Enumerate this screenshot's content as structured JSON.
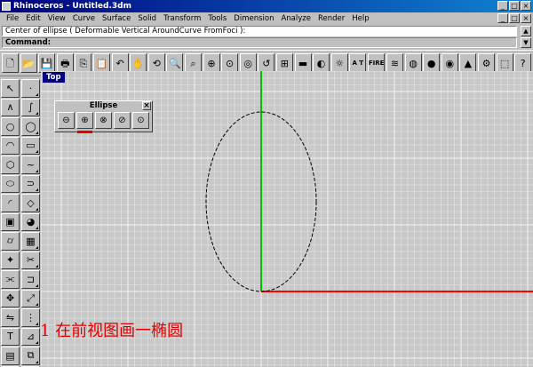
{
  "window": {
    "title": "Rhinoceros - Untitled.3dm",
    "min": "_",
    "max": "□",
    "close": "×"
  },
  "menu": [
    "File",
    "Edit",
    "View",
    "Curve",
    "Surface",
    "Solid",
    "Transform",
    "Tools",
    "Dimension",
    "Analyze",
    "Render",
    "Help"
  ],
  "mdi": {
    "min": "_",
    "max": "□",
    "close": "×"
  },
  "command": {
    "history": "Center of ellipse ( Deformable Vertical AroundCurve FromFoci ):",
    "prompt": "Command:"
  },
  "toolbar": {
    "buttons": [
      {
        "name": "new-icon",
        "glyph": "🗋"
      },
      {
        "name": "open-icon",
        "glyph": "📂"
      },
      {
        "name": "save-icon",
        "glyph": "💾"
      },
      {
        "name": "print-icon",
        "glyph": "🖶"
      },
      {
        "name": "copy-icon",
        "glyph": "⎘"
      },
      {
        "name": "paste-icon",
        "glyph": "📋"
      },
      {
        "name": "undo-icon",
        "glyph": "↶"
      },
      {
        "name": "pan-icon",
        "glyph": "✋"
      },
      {
        "name": "rotate-view-icon",
        "glyph": "⟲"
      },
      {
        "name": "zoom-icon",
        "glyph": "🔍"
      },
      {
        "name": "zoom-window-icon",
        "glyph": "⌕"
      },
      {
        "name": "zoom-extents-icon",
        "glyph": "⊕"
      },
      {
        "name": "zoom-selected-icon",
        "glyph": "⊙"
      },
      {
        "name": "zoom-target-icon",
        "glyph": "◎"
      },
      {
        "name": "undo-view-icon",
        "glyph": "↺"
      },
      {
        "name": "four-views-icon",
        "glyph": "⊞"
      },
      {
        "name": "cplane-icon",
        "glyph": "▬"
      },
      {
        "name": "shade-icon",
        "glyph": "◐"
      },
      {
        "name": "render-icon",
        "glyph": "☼"
      },
      {
        "name": "text-lbl-icon",
        "glyph": "A T",
        "label": true
      },
      {
        "name": "osnap-icon",
        "glyph": "FIRE",
        "label": true
      },
      {
        "name": "layer-icon",
        "glyph": "≋"
      },
      {
        "name": "color-wheel-icon",
        "glyph": "◍"
      },
      {
        "name": "sphere-icon",
        "glyph": "●"
      },
      {
        "name": "material-icon",
        "glyph": "◉"
      },
      {
        "name": "light-icon",
        "glyph": "▲"
      },
      {
        "name": "options-icon",
        "glyph": "⚙"
      },
      {
        "name": "properties-icon",
        "glyph": "⬚"
      },
      {
        "name": "help-icon",
        "glyph": "?"
      }
    ]
  },
  "left_toolbar": {
    "buttons": [
      {
        "name": "select-icon",
        "glyph": "↖"
      },
      {
        "name": "point-icon",
        "glyph": "·"
      },
      {
        "name": "polyline-icon",
        "glyph": "∧"
      },
      {
        "name": "curve-icon",
        "glyph": "∫"
      },
      {
        "name": "circle-icon",
        "glyph": "○"
      },
      {
        "name": "ellipse-icon",
        "glyph": "◯"
      },
      {
        "name": "arc-icon",
        "glyph": "◠"
      },
      {
        "name": "rectangle-icon",
        "glyph": "▭"
      },
      {
        "name": "polygon-icon",
        "glyph": "⬡"
      },
      {
        "name": "freeform-icon",
        "glyph": "~"
      },
      {
        "name": "text-object-icon",
        "glyph": "⬭"
      },
      {
        "name": "offset-icon",
        "glyph": "⊃"
      },
      {
        "name": "fillet-icon",
        "glyph": "◜"
      },
      {
        "name": "surface-icon",
        "glyph": "◇"
      },
      {
        "name": "box-icon",
        "glyph": "▣"
      },
      {
        "name": "sphere-solid-icon",
        "glyph": "◕"
      },
      {
        "name": "cylinder-icon",
        "glyph": "⌭"
      },
      {
        "name": "mesh-icon",
        "glyph": "▦"
      },
      {
        "name": "explode-icon",
        "glyph": "✦"
      },
      {
        "name": "trim-icon",
        "glyph": "✂"
      },
      {
        "name": "split-icon",
        "glyph": "⫘"
      },
      {
        "name": "join-icon",
        "glyph": "⊐"
      },
      {
        "name": "move-icon",
        "glyph": "✥"
      },
      {
        "name": "scale-icon",
        "glyph": "⤢"
      },
      {
        "name": "mirror-icon",
        "glyph": "⇋"
      },
      {
        "name": "array-icon",
        "glyph": "⋮"
      },
      {
        "name": "text-icon",
        "glyph": "T"
      },
      {
        "name": "dimension-icon",
        "glyph": "⊿"
      },
      {
        "name": "hatch-icon",
        "glyph": "▤"
      },
      {
        "name": "layout-icon",
        "glyph": "⧉"
      },
      {
        "name": "view-icon",
        "glyph": "▣"
      },
      {
        "name": "snap-icon",
        "glyph": "⌗"
      }
    ]
  },
  "viewport": {
    "label": "Top",
    "grid_color": "#e8e8e8",
    "background": "#c8c8c8",
    "x_axis_color": "#ff0000",
    "y_axis_color": "#00c000"
  },
  "ellipse_toolbar": {
    "title": "Ellipse",
    "close": "×",
    "buttons": [
      {
        "name": "ellipse-center-icon",
        "glyph": "⊖"
      },
      {
        "name": "ellipse-diameter-icon",
        "glyph": "⊕",
        "active": true
      },
      {
        "name": "ellipse-foci-icon",
        "glyph": "⊗"
      },
      {
        "name": "ellipse-around-curve-icon",
        "glyph": "⊘"
      },
      {
        "name": "ellipse-vertical-icon",
        "glyph": "⊙"
      }
    ]
  },
  "annotation": {
    "text": "1 在前视图画一椭圆",
    "color": "#e00000"
  }
}
